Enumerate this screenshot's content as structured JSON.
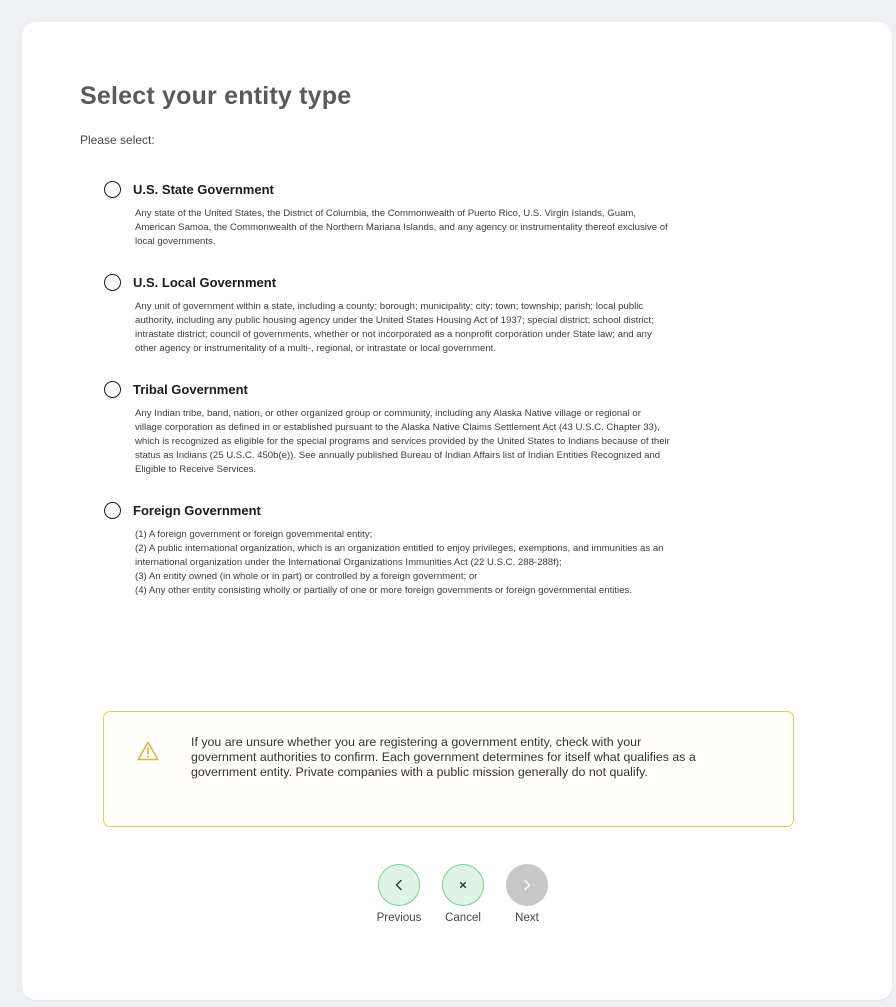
{
  "page": {
    "title": "Select your entity type",
    "instruction": "Please select:"
  },
  "options": [
    {
      "label": "U.S. State Government",
      "description": [
        "Any state of the United States, the District of Columbia, the Commonwealth of Puerto Rico, U.S. Virgin Islands, Guam,",
        "American Samoa, the Commonwealth of the Northern Mariana Islands, and any agency or instrumentality thereof exclusive of",
        "local governments."
      ]
    },
    {
      "label": "U.S. Local Government",
      "description": [
        "Any unit of government within a state, including a county; borough; municipality; city; town; township; parish; local public",
        "authority, including any public housing agency under the United States Housing Act of 1937; special district; school district;",
        "intrastate district; council of governments, whether or not incorporated as a nonprofit corporation under State law; and any",
        "other agency or instrumentality of a multi-, regional, or intrastate or local government."
      ]
    },
    {
      "label": "Tribal Government",
      "description": [
        "Any Indian tribe, band, nation, or other organized group or community, including any Alaska Native village or regional or",
        "village corporation as defined in or established pursuant to the Alaska Native Claims Settlement Act (43 U.S.C. Chapter 33),",
        "which is recognized as eligible for the special programs and services provided by the United States to Indians because of their",
        "status as Indians (25 U.S.C. 450b(e)). See annually published Bureau of Indian Affairs list of Indian Entities Recognized and",
        "Eligible to Receive Services."
      ]
    },
    {
      "label": "Foreign Government",
      "description": [
        "(1) A foreign government or foreign governmental entity;",
        "(2) A public international organization, which is an organization entitled to enjoy privileges, exemptions, and immunities as an",
        "international organization under the International Organizations Immunities Act (22 U.S.C. 288-288f);",
        "(3) An entity owned (in whole or in part) or controlled by a foreign government; or",
        "(4) Any other entity consisting wholly or partially of one or more foreign governments or foreign governmental entities."
      ]
    }
  ],
  "alert": {
    "icon": "warning-icon",
    "color": "#e8c66a",
    "lines": [
      "If you are unsure whether you are registering a government entity, check with your",
      "government authorities to confirm. Each government determines for itself what qualifies as a",
      "government entity. Private companies with a public mission generally do not qualify."
    ]
  },
  "nav": {
    "previous_label": "Previous",
    "cancel_label": "Cancel",
    "next_label": "Next",
    "accent_color": "#7fcf93",
    "disabled_color": "#c8c8c8"
  }
}
